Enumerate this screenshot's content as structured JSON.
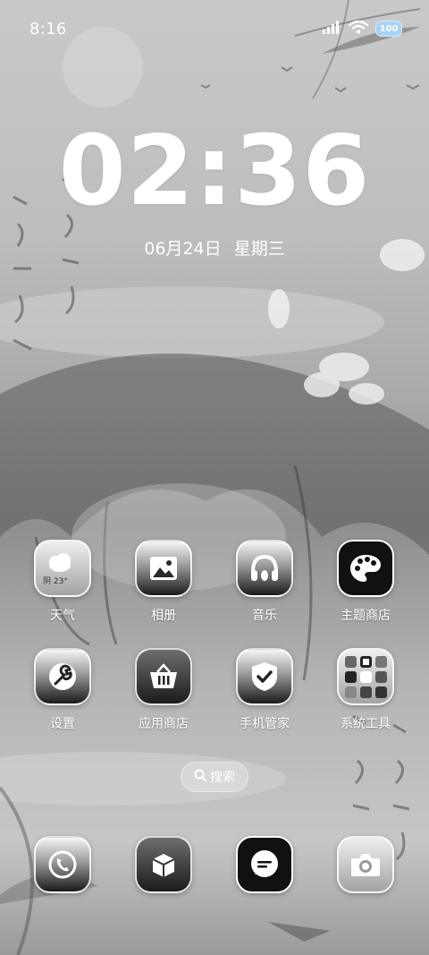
{
  "status_bar": {
    "time": "8:16",
    "battery_level": "100",
    "icons": [
      "signal-icon",
      "wifi-icon",
      "battery-icon"
    ]
  },
  "lockclock": {
    "time": "02:36",
    "date": "06月24日",
    "weekday": "星期三"
  },
  "apps_row1": [
    {
      "label": "天气",
      "icon": "weather-icon",
      "weather": "阴 23°"
    },
    {
      "label": "相册",
      "icon": "gallery-icon"
    },
    {
      "label": "音乐",
      "icon": "music-icon"
    },
    {
      "label": "主题商店",
      "icon": "palette-icon"
    }
  ],
  "apps_row2": [
    {
      "label": "设置",
      "icon": "settings-icon"
    },
    {
      "label": "应用商店",
      "icon": "store-basket-icon"
    },
    {
      "label": "手机管家",
      "icon": "shield-check-icon"
    },
    {
      "label": "系统工具",
      "icon": "folder-icon"
    }
  ],
  "search": {
    "label": "搜索",
    "icon": "search-icon"
  },
  "dock": [
    {
      "icon": "phone-icon"
    },
    {
      "icon": "browser-cube-icon"
    },
    {
      "icon": "message-icon"
    },
    {
      "icon": "camera-icon"
    }
  ],
  "colors": {
    "battery": "#a6d3f5",
    "text": "#ffffff"
  }
}
